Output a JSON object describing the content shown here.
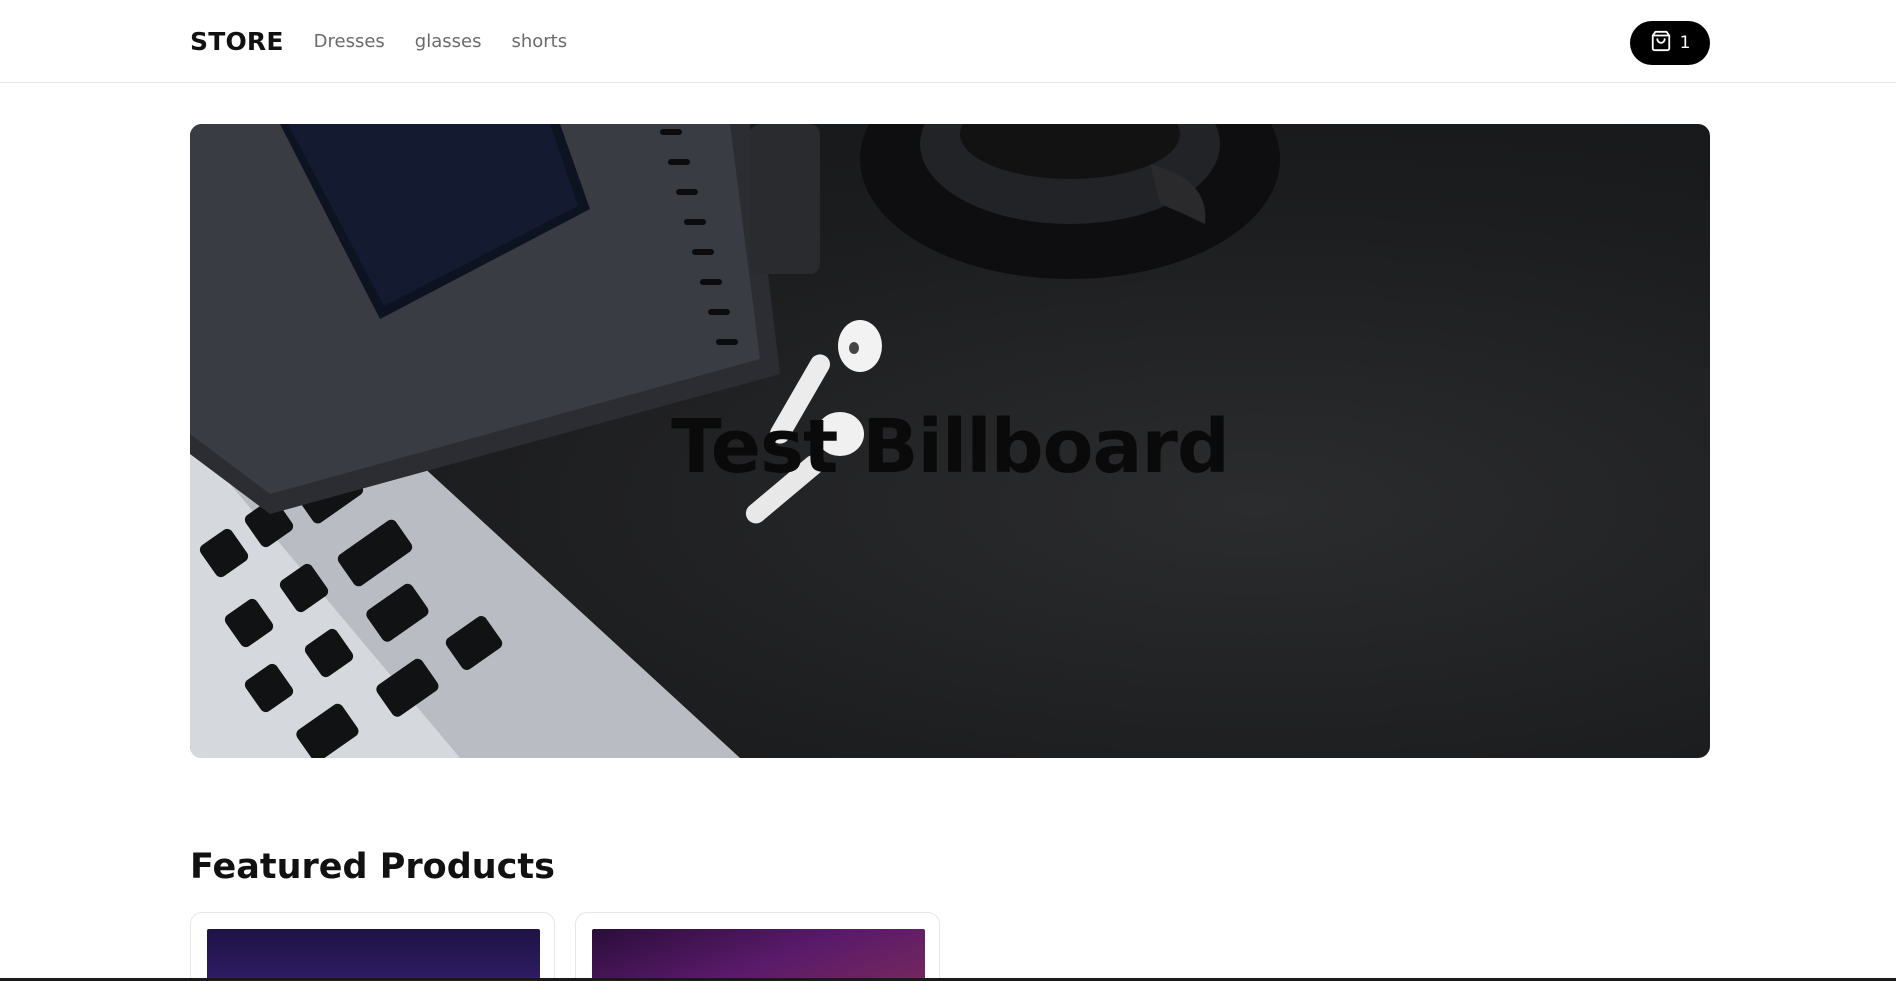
{
  "navbar": {
    "brand": "STORE",
    "links": [
      {
        "label": "Dresses"
      },
      {
        "label": "glasses"
      },
      {
        "label": "shorts"
      }
    ],
    "cart": {
      "icon": "shopping-bag-icon",
      "count": "1"
    }
  },
  "billboard": {
    "title": "Test Billboard"
  },
  "featured": {
    "title": "Featured Products",
    "products": [
      {
        "image": "galaxy-image"
      },
      {
        "image": "nebula-image"
      }
    ]
  },
  "colors": {
    "accent": "#000000",
    "text": "#111111",
    "muted": "#6b6b6b"
  }
}
